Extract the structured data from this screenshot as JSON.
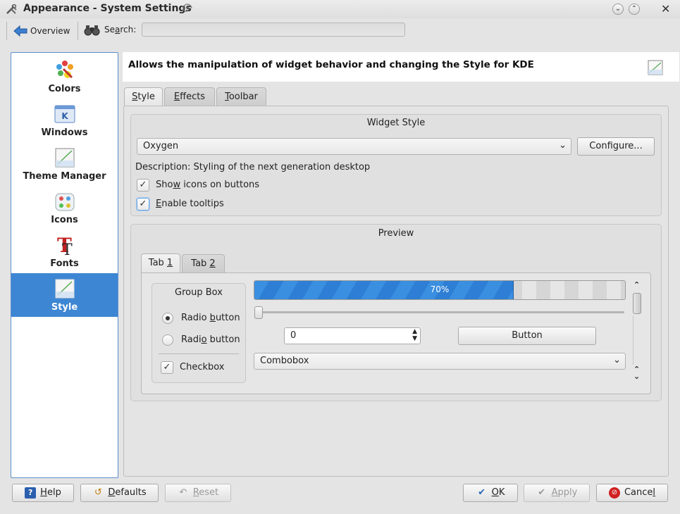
{
  "window": {
    "title": "Appearance - System Settings",
    "controls": [
      "minimize",
      "maximize",
      "close"
    ]
  },
  "toolbar": {
    "overview_label": "Overview",
    "search_label": "Search:",
    "search_value": ""
  },
  "sidebar": {
    "items": [
      {
        "label": "Colors",
        "icon": "colors-icon"
      },
      {
        "label": "Windows",
        "icon": "windows-icon"
      },
      {
        "label": "Theme Manager",
        "icon": "theme-manager-icon"
      },
      {
        "label": "Icons",
        "icon": "icons-icon"
      },
      {
        "label": "Fonts",
        "icon": "fonts-icon"
      },
      {
        "label": "Style",
        "icon": "style-icon",
        "selected": true
      }
    ]
  },
  "header": {
    "description": "Allows the manipulation of widget behavior and changing the Style for KDE"
  },
  "tabs": [
    {
      "label": "Style",
      "mnemonic": "S",
      "rest": "tyle",
      "active": true
    },
    {
      "label": "Effects",
      "mnemonic": "E",
      "rest": "ffects"
    },
    {
      "label": "Toolbar",
      "mnemonic": "T",
      "rest": "oolbar"
    }
  ],
  "widget_style": {
    "group_title": "Widget Style",
    "selected_style": "Oxygen",
    "configure_label": "Configure...",
    "description": "Description: Styling of the next generation desktop",
    "show_icons": {
      "pre": "Sho",
      "mnemonic": "w",
      "post": " icons on buttons",
      "checked": true
    },
    "enable_tooltips": {
      "pre": "",
      "mnemonic": "E",
      "post": "nable tooltips",
      "checked": true
    }
  },
  "preview": {
    "group_title": "Preview",
    "tabs": [
      {
        "pre": "Tab ",
        "mnemonic": "1",
        "active": true
      },
      {
        "pre": "Tab ",
        "mnemonic": "2"
      }
    ],
    "group_box_title": "Group Box",
    "radio1": {
      "pre": "Radio ",
      "mnemonic": "b",
      "post": "utton",
      "checked": true
    },
    "radio2": {
      "pre": "Radi",
      "mnemonic": "o",
      "post": " button",
      "checked": false
    },
    "checkbox": {
      "label": "Checkbox",
      "checked": true
    },
    "progress": {
      "value": 0.7,
      "label": "70%"
    },
    "slider_value": 0,
    "spin_value": "0",
    "button_label": "Button",
    "combobox_label": "Combobox"
  },
  "footer": {
    "help": {
      "mnemonic": "H",
      "rest": "elp"
    },
    "defaults": {
      "mnemonic": "D",
      "rest": "efaults"
    },
    "reset": {
      "mnemonic": "R",
      "rest": "eset",
      "disabled": true
    },
    "ok": {
      "mnemonic": "O",
      "rest": "K"
    },
    "apply": {
      "mnemonic": "A",
      "rest": "pply",
      "disabled": true
    },
    "cancel": {
      "pre": "Cance",
      "mnemonic": "l"
    }
  },
  "colors": {
    "accent": "#3d86d3",
    "progress": "#3a8fe0"
  }
}
